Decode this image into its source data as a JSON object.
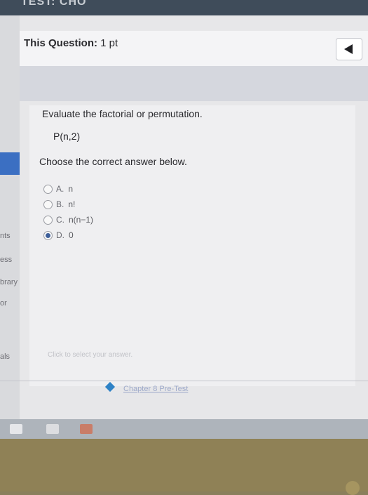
{
  "window": {
    "title_fragment": "TEST: CHO"
  },
  "sidebar": {
    "items": [
      "nts",
      "ess",
      "brary",
      "or",
      "als"
    ]
  },
  "header": {
    "label_bold": "This Question:",
    "label_value": " 1 pt"
  },
  "question": {
    "prompt": "Evaluate the factorial or permutation.",
    "expression": "P(n,2)",
    "instruction": "Choose the correct answer below."
  },
  "options": [
    {
      "letter": "A.",
      "text": "n",
      "selected": false
    },
    {
      "letter": "B.",
      "text": "n!",
      "selected": false
    },
    {
      "letter": "C.",
      "text": "n(n−1)",
      "selected": false
    },
    {
      "letter": "D.",
      "text": "0",
      "selected": true
    }
  ],
  "hint": "Click to select your answer.",
  "footer": {
    "link_text": "Chapter 8 Pre-Test"
  },
  "colors": {
    "accent": "#3b6fc2",
    "selected_radio": "#3d5f9a"
  }
}
